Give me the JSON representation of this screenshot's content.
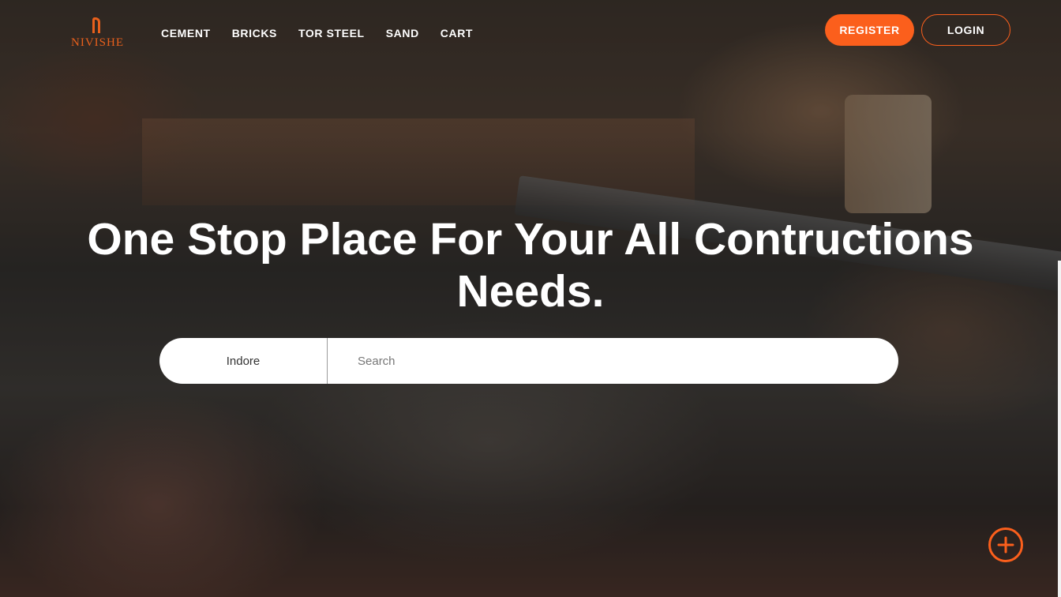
{
  "brand": {
    "logo_text": "NIVISHE",
    "accent": "#fb5f1c"
  },
  "nav": {
    "items": [
      {
        "label": "CEMENT"
      },
      {
        "label": "BRICKS"
      },
      {
        "label": "TOR STEEL"
      },
      {
        "label": "SAND"
      },
      {
        "label": "CART"
      }
    ]
  },
  "auth": {
    "register_label": "REGISTER",
    "login_label": "LOGIN"
  },
  "hero": {
    "title": "One Stop Place For Your All Contructions Needs."
  },
  "search": {
    "location": "Indore",
    "placeholder": "Search",
    "value": ""
  },
  "fab": {
    "icon": "plus-circle-icon"
  }
}
